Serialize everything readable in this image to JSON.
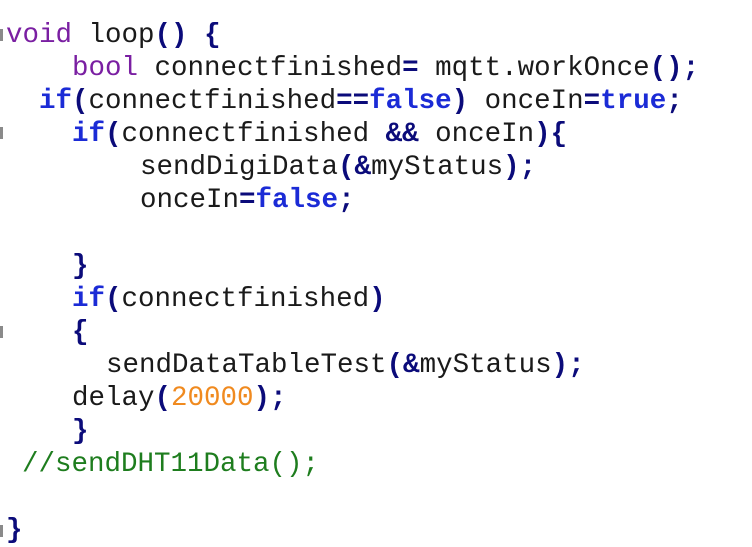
{
  "code": {
    "kw_void": "void",
    "fn_loop": "loop",
    "kw_bool": "bool",
    "id_connectfinished": "connectfinished",
    "id_mqtt": "mqtt",
    "id_workOnce": "workOnce",
    "kw_if": "if",
    "kw_false": "false",
    "kw_true": "true",
    "id_onceIn": "onceIn",
    "fn_sendDigiData": "sendDigiData",
    "id_myStatus": "myStatus",
    "fn_sendDataTableTest": "sendDataTableTest",
    "fn_delay": "delay",
    "num_delay": "20000",
    "comment_dht": "//sendDHT11Data();"
  },
  "colors": {
    "keyword_type": "#7a1fa2",
    "keyword_control": "#1b2bd6",
    "punctuation": "#0b0b7a",
    "number": "#f08a1f",
    "comment": "#1e7d1e"
  }
}
